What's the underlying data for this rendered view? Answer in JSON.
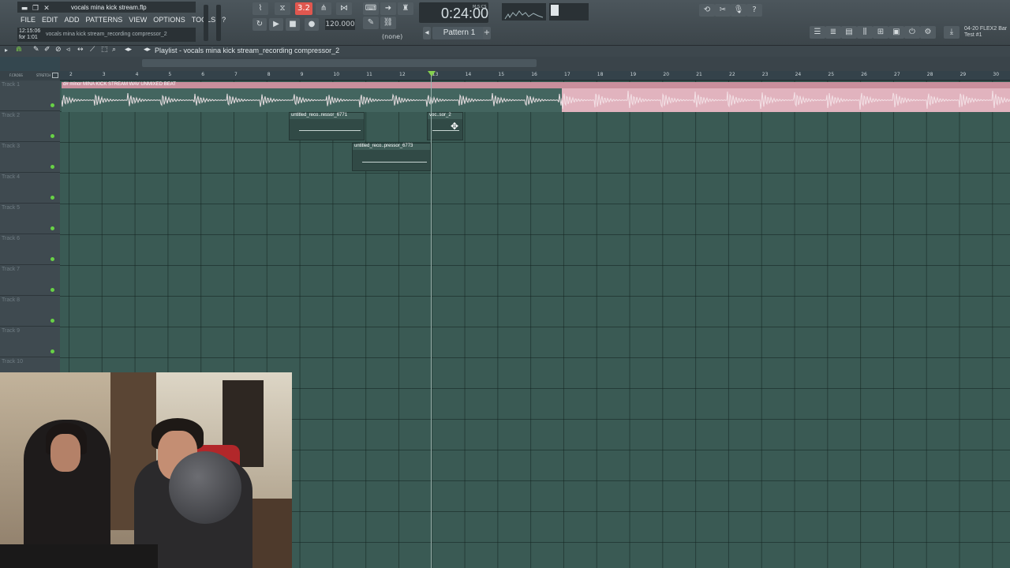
{
  "window": {
    "filename": "vocals mina kick stream.flp",
    "hint_time": "12:15:06",
    "hint_time2": "for 1:01",
    "hint_text": "vocals mina kick stream_recording compressor_2"
  },
  "menu": [
    "FILE",
    "EDIT",
    "ADD",
    "PATTERNS",
    "VIEW",
    "OPTIONS",
    "TOOLS",
    "?"
  ],
  "transport": {
    "pat_song": "3.2",
    "tempo": "120.000",
    "time": "0:24:00",
    "time_label": "M:S:CS",
    "pattern": "Pattern 1",
    "none_label": "(none)"
  },
  "plugin_title": {
    "line1": "04-20  FLEX2 Bar",
    "line2": "Test #1"
  },
  "playlist": {
    "title": "Playlist - vocals mina kick stream_recording compressor_2",
    "bar_numbers": [
      "2",
      "3",
      "4",
      "5",
      "6",
      "7",
      "8",
      "9",
      "10",
      "11",
      "12",
      "13",
      "14",
      "15",
      "16",
      "17",
      "18",
      "19",
      "20",
      "21",
      "22",
      "23",
      "24",
      "25",
      "26",
      "27",
      "28",
      "29",
      "30"
    ],
    "tracks": [
      "Track 1",
      "Track 2",
      "Track 3",
      "Track 4",
      "Track 5",
      "Track 6",
      "Track 7",
      "Track 8",
      "Track 9",
      "Track 10"
    ],
    "clips": {
      "beat": "d# minor MINA KICK STREAM WAV UNMIXED BEAT",
      "clip_a": "untitled_reco..ressor_6771",
      "clip_b": "voc..sor_2",
      "clip_c": "untitled_reco..pressor_6773"
    },
    "header_labels": {
      "left": "F.CROSS",
      "right": "STRETCH"
    }
  },
  "colors": {
    "grid": "#3a5a54",
    "beat_clip": "#e1b3be",
    "pat_song_active": "#e0574f",
    "track_led": "#68d146"
  }
}
